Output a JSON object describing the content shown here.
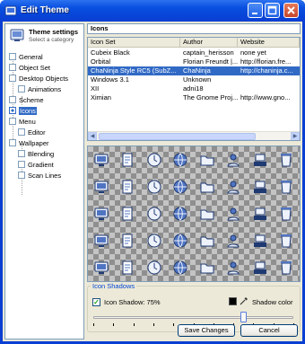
{
  "window": {
    "title": "Edit Theme"
  },
  "left_panel": {
    "header_title": "Theme settings",
    "header_subtitle": "Select a category",
    "items": [
      {
        "label": "General",
        "level": 0
      },
      {
        "label": "Object Set",
        "level": 0
      },
      {
        "label": "Desktop Objects",
        "level": 0
      },
      {
        "label": "Animations",
        "level": 1
      },
      {
        "label": "Scheme",
        "level": 0
      },
      {
        "label": "Icons",
        "level": 0,
        "selected": true
      },
      {
        "label": "Menu",
        "level": 0
      },
      {
        "label": "Editor",
        "level": 1
      },
      {
        "label": "Wallpaper",
        "level": 0
      },
      {
        "label": "Blending",
        "level": 1
      },
      {
        "label": "Gradient",
        "level": 1
      },
      {
        "label": "Scan Lines",
        "level": 1
      }
    ]
  },
  "section_title": "Icons",
  "icon_table": {
    "columns": [
      "Icon Set",
      "Author",
      "Website"
    ],
    "rows": [
      [
        "Cubeix Black",
        "captain_herisson",
        "none yet"
      ],
      [
        "Orbital",
        "Florian Freundt |...",
        "http://florian.fre..."
      ],
      [
        "ChaNinja Style RC5 (SubZ...",
        "ChaNinja",
        "http://chaninja.c..."
      ],
      [
        "Windows 3.1",
        "Unknown",
        ""
      ],
      [
        "XII",
        "adni18",
        ""
      ],
      [
        "Ximian",
        "The Gnome Proj...",
        "http://www.gno..."
      ]
    ],
    "selected_row": 2
  },
  "preview": {
    "icons": [
      "computer-icon",
      "documents-icon",
      "clock-icon",
      "globe-icon",
      "folder-icon",
      "user-icon",
      "network-icon",
      "recycle-icon",
      "mail-icon",
      "font-icon",
      "music-icon",
      "control-panel-icon",
      "printer-icon",
      "search-icon",
      "help-icon",
      "run-icon",
      "display-icon",
      "calendar-icon",
      "camera-icon",
      "monitor-icon",
      "keyboard-icon",
      "drive-icon",
      "folder-blue-icon",
      "hardware-icon",
      "picture-icon",
      "disk-icon",
      "word-icon",
      "note-icon",
      "stack-icon",
      "chart-icon",
      "scanner-icon",
      "tools-icon",
      "trash-icon",
      "users-icon",
      "mouse-icon",
      "doc-icon",
      "gear-icon",
      "fax-icon",
      "star-icon",
      "arrow-icon"
    ]
  },
  "icon_shadows": {
    "legend": "Icon Shadows",
    "checkbox_label": "Icon Shadow: 75%",
    "checked": true,
    "value": 75,
    "shadow_color_label": "Shadow color",
    "shadow_color": "#000000"
  },
  "buttons": {
    "save": "Save Changes",
    "cancel": "Cancel"
  },
  "colors": {
    "title_bar": "#0a50e0",
    "selection": "#316ac5",
    "legend_text": "#0046d5"
  }
}
